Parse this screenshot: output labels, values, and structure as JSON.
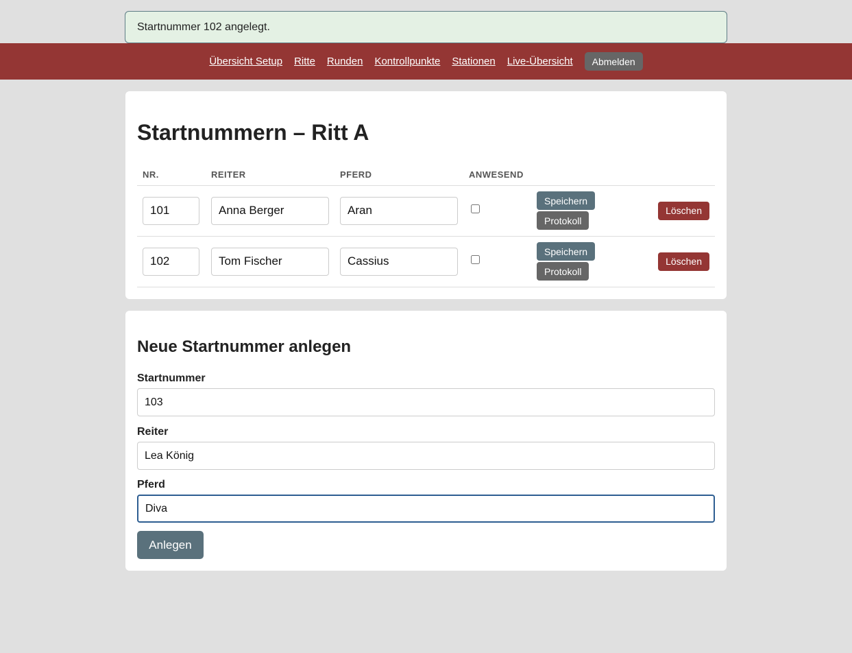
{
  "flash": {
    "message": "Startnummer 102 angelegt."
  },
  "nav": {
    "links": [
      "Übersicht Setup",
      "Ritte",
      "Runden",
      "Kontrollpunkte",
      "Stationen",
      "Live-Übersicht"
    ],
    "logout_label": "Abmelden"
  },
  "list": {
    "title": "Startnummern – Ritt A",
    "columns": [
      "NR.",
      "REITER",
      "PFERD",
      "ANWESEND",
      ""
    ],
    "rows": [
      {
        "nr": "101",
        "reiter": "Anna Berger",
        "pferd": "Aran",
        "anwesend": false
      },
      {
        "nr": "102",
        "reiter": "Tom Fischer",
        "pferd": "Cassius",
        "anwesend": false
      }
    ],
    "save_label": "Speichern",
    "log_label": "Protokoll",
    "delete_label": "Löschen"
  },
  "form": {
    "title": "Neue Startnummer anlegen",
    "startnummer_label": "Startnummer",
    "startnummer_value": "103",
    "reiter_label": "Reiter",
    "reiter_value": "Lea König",
    "pferd_label": "Pferd",
    "pferd_value": "Diva",
    "submit_label": "Anlegen"
  }
}
